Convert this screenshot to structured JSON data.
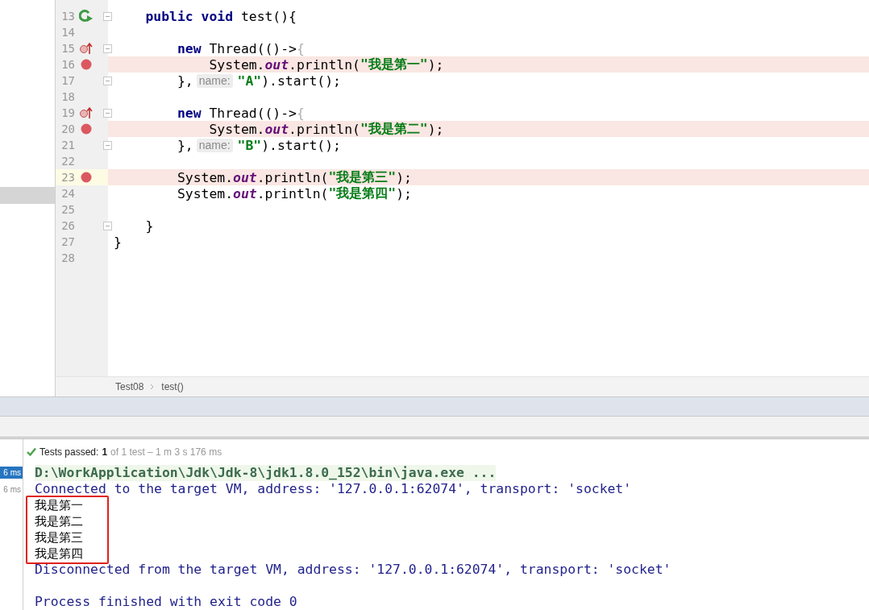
{
  "editor": {
    "lines": [
      {
        "number": "13",
        "gutter_icon": {
          "kind": "run"
        },
        "breakpoint": false,
        "fold": true,
        "highlighted": false,
        "current": false,
        "tokens": [
          {
            "kind": "keyword",
            "text": "    public void"
          },
          {
            "kind": "plain",
            "text": " test(){"
          }
        ]
      },
      {
        "number": "14",
        "breakpoint": false,
        "fold": false,
        "highlighted": false,
        "current": false
      },
      {
        "number": "15",
        "gutter_icon": {
          "kind": "override"
        },
        "breakpoint": false,
        "fold": true,
        "highlighted": false,
        "current": false,
        "tokens": [
          {
            "kind": "keyword",
            "text": "        new"
          },
          {
            "kind": "plain",
            "text": " Thread(()->"
          },
          {
            "kind": "dim",
            "text": "{"
          }
        ]
      },
      {
        "number": "16",
        "breakpoint": true,
        "fold": false,
        "highlighted": true,
        "current": false,
        "tokens": [
          {
            "kind": "plain",
            "text": "            System."
          },
          {
            "kind": "field",
            "text": "out"
          },
          {
            "kind": "plain",
            "text": ".println("
          },
          {
            "kind": "string",
            "text": "\"我是第一\""
          },
          {
            "kind": "plain",
            "text": ");"
          }
        ]
      },
      {
        "number": "17",
        "breakpoint": false,
        "fold": true,
        "highlighted": false,
        "current": false,
        "tokens": [
          {
            "kind": "plain",
            "text": "        },"
          },
          {
            "kind": "hint",
            "text": "name:"
          },
          {
            "kind": "string",
            "text": "\"A\""
          },
          {
            "kind": "plain",
            "text": ").start();"
          }
        ]
      },
      {
        "number": "18",
        "breakpoint": false,
        "fold": false,
        "highlighted": false,
        "current": false
      },
      {
        "number": "19",
        "gutter_icon": {
          "kind": "override"
        },
        "breakpoint": false,
        "fold": true,
        "highlighted": false,
        "current": false,
        "tokens": [
          {
            "kind": "keyword",
            "text": "        new"
          },
          {
            "kind": "plain",
            "text": " Thread(()->"
          },
          {
            "kind": "dim",
            "text": "{"
          }
        ]
      },
      {
        "number": "20",
        "breakpoint": true,
        "fold": false,
        "highlighted": true,
        "current": false,
        "tokens": [
          {
            "kind": "plain",
            "text": "            System."
          },
          {
            "kind": "field",
            "text": "out"
          },
          {
            "kind": "plain",
            "text": ".println("
          },
          {
            "kind": "string",
            "text": "\"我是第二\""
          },
          {
            "kind": "plain",
            "text": ");"
          }
        ]
      },
      {
        "number": "21",
        "breakpoint": false,
        "fold": true,
        "highlighted": false,
        "current": false,
        "tokens": [
          {
            "kind": "plain",
            "text": "        },"
          },
          {
            "kind": "hint",
            "text": "name:"
          },
          {
            "kind": "string",
            "text": "\"B\""
          },
          {
            "kind": "plain",
            "text": ").start();"
          }
        ]
      },
      {
        "number": "22",
        "breakpoint": false,
        "fold": false,
        "highlighted": false,
        "current": false
      },
      {
        "number": "23",
        "breakpoint": true,
        "fold": false,
        "highlighted": true,
        "current": true,
        "tokens": [
          {
            "kind": "plain",
            "text": "        System."
          },
          {
            "kind": "field",
            "text": "out"
          },
          {
            "kind": "plain",
            "text": ".println("
          },
          {
            "kind": "string",
            "text": "\"我是第三\""
          },
          {
            "kind": "plain",
            "text": ");"
          }
        ]
      },
      {
        "number": "24",
        "breakpoint": false,
        "fold": false,
        "highlighted": false,
        "current": false,
        "tokens": [
          {
            "kind": "plain",
            "text": "        System."
          },
          {
            "kind": "field",
            "text": "out"
          },
          {
            "kind": "plain",
            "text": ".println("
          },
          {
            "kind": "string",
            "text": "\"我是第四\""
          },
          {
            "kind": "plain",
            "text": ");"
          }
        ]
      },
      {
        "number": "25",
        "breakpoint": false,
        "fold": false,
        "highlighted": false,
        "current": false
      },
      {
        "number": "26",
        "breakpoint": false,
        "fold": true,
        "highlighted": false,
        "current": false,
        "tokens": [
          {
            "kind": "plain",
            "text": "    }"
          }
        ]
      },
      {
        "number": "27",
        "breakpoint": false,
        "fold": false,
        "highlighted": false,
        "current": false,
        "tokens": [
          {
            "kind": "plain",
            "text": "}"
          }
        ]
      },
      {
        "number": "28",
        "breakpoint": false,
        "fold": false,
        "highlighted": false,
        "current": false
      }
    ],
    "breadcrumbs": [
      "Test08",
      "test()"
    ]
  },
  "test_status": {
    "passed": true,
    "label": "Tests passed:",
    "count": "1",
    "detail": "of 1 test – 1 m 3 s 176 ms"
  },
  "test_tree": [
    {
      "time": "6 ms",
      "selected": true
    },
    {
      "time": "6 ms",
      "selected": false
    }
  ],
  "console": {
    "highlight_output": true,
    "lines": [
      {
        "kind": "command",
        "text": "D:\\WorkApplication\\Jdk\\Jdk-8\\jdk1.8.0_152\\bin\\java.exe ..."
      },
      {
        "kind": "info",
        "text": "Connected to the target VM, address: '127.0.0.1:62074', transport: 'socket'"
      },
      {
        "kind": "output",
        "text": "我是第一"
      },
      {
        "kind": "output",
        "text": "我是第二"
      },
      {
        "kind": "output",
        "text": "我是第三"
      },
      {
        "kind": "output",
        "text": "我是第四"
      },
      {
        "kind": "info",
        "text": "Disconnected from the target VM, address: '127.0.0.1:62074', transport: 'socket'"
      },
      {
        "kind": "blank"
      },
      {
        "kind": "info",
        "text": "Process finished with exit code 0"
      }
    ]
  }
}
